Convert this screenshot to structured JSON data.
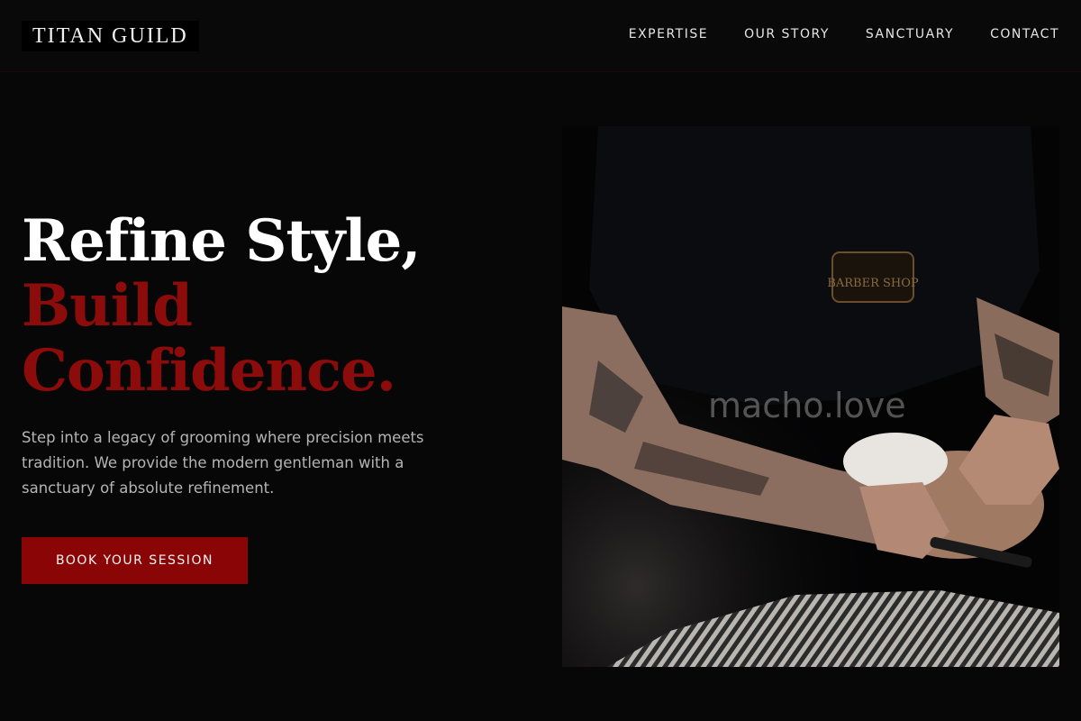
{
  "brand": {
    "name": "TITAN GUILD"
  },
  "nav": {
    "items": [
      {
        "label": "EXPERTISE"
      },
      {
        "label": "OUR STORY"
      },
      {
        "label": "SANCTUARY"
      },
      {
        "label": "CONTACT"
      }
    ]
  },
  "hero": {
    "title_line1": "Refine Style,",
    "title_line2": "Build",
    "title_line3": "Confidence.",
    "description": "Step into a legacy of grooming where precision meets tradition. We provide the modern gentleman with a sanctuary of absolute refinement.",
    "cta_label": "BOOK YOUR SESSION"
  },
  "image": {
    "watermark": "macho.love",
    "shirt_logo_text": "BARBER SHOP"
  },
  "colors": {
    "background": "#070707",
    "accent": "#8a0606",
    "text": "#ffffff",
    "muted_text": "#b4b4b4"
  }
}
